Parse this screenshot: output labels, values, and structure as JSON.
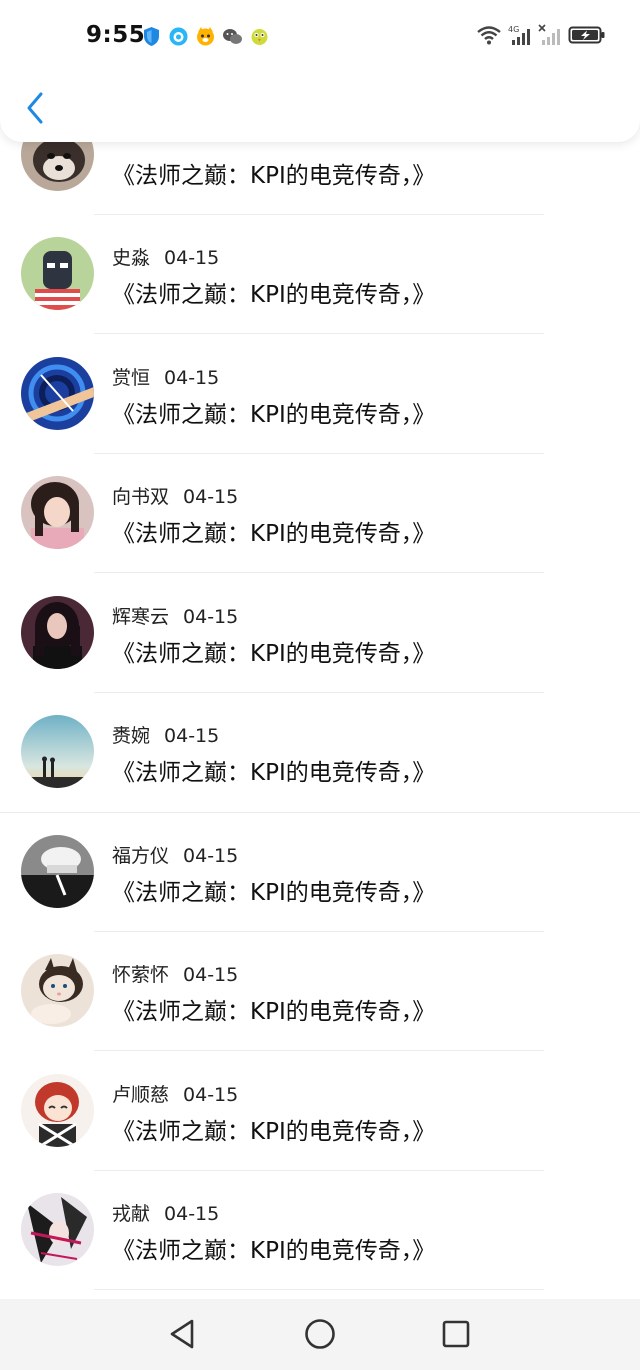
{
  "status_bar": {
    "time": "9:55",
    "network_type": "4G"
  },
  "comments": [
    {
      "name": "",
      "date": "",
      "text": "《法师之巅：KPI的电竞传奇，》",
      "avatar": "husky-dog"
    },
    {
      "name": "史淼",
      "date": "04-15",
      "text": "《法师之巅：KPI的电竞传奇，》",
      "avatar": "masked-figure"
    },
    {
      "name": "赏恒",
      "date": "04-15",
      "text": "《法师之巅：KPI的电竞传奇，》",
      "avatar": "blue-swirl"
    },
    {
      "name": "向书双",
      "date": "04-15",
      "text": "《法师之巅：KPI的电竞传奇，》",
      "avatar": "girl-portrait"
    },
    {
      "name": "辉寒云",
      "date": "04-15",
      "text": "《法师之巅：KPI的电竞传奇，》",
      "avatar": "woman-dark-hair"
    },
    {
      "name": "赉婉",
      "date": "04-15",
      "text": "《法师之巅：KPI的电竞传奇，》",
      "avatar": "sunset-couple"
    },
    {
      "name": "福方仪",
      "date": "04-15",
      "text": "《法师之巅：KPI的电竞传奇，》",
      "avatar": "bw-cap"
    },
    {
      "name": "怀萦怀",
      "date": "04-15",
      "text": "《法师之巅：KPI的电竞传奇，》",
      "avatar": "kitten"
    },
    {
      "name": "卢顺慈",
      "date": "04-15",
      "text": "《法师之巅：KPI的电竞传奇，》",
      "avatar": "anime-redhead"
    },
    {
      "name": "戎献",
      "date": "04-15",
      "text": "《法师之巅：KPI的电竞传奇，》",
      "avatar": "anime-dark"
    }
  ],
  "colors": {
    "accent": "#1e88e5",
    "text": "#111111",
    "divider": "#ececec",
    "nav_bar": "#f4f4f4"
  }
}
